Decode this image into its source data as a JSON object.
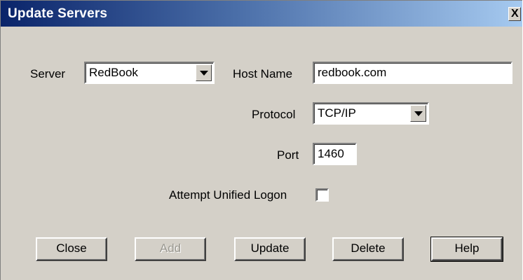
{
  "window": {
    "title": "Update Servers",
    "close_glyph": "X"
  },
  "form": {
    "server_label": "Server",
    "server_value": "RedBook",
    "host_label": "Host Name",
    "host_value": "redbook.com",
    "protocol_label": "Protocol",
    "protocol_value": "TCP/IP",
    "port_label": "Port",
    "port_value": "1460",
    "unified_logon_label": "Attempt Unified Logon",
    "unified_logon_checked": false
  },
  "buttons": {
    "close": "Close",
    "add": "Add",
    "update": "Update",
    "delete": "Delete",
    "help": "Help"
  },
  "icons": {
    "dropdown": "chevron-down-icon",
    "close": "close-icon"
  },
  "colors": {
    "dialog_bg": "#d4d0c8",
    "title_start": "#0a246a",
    "title_end": "#a6caf0",
    "title_text": "#ffffff",
    "disabled_text": "#9a9890"
  }
}
